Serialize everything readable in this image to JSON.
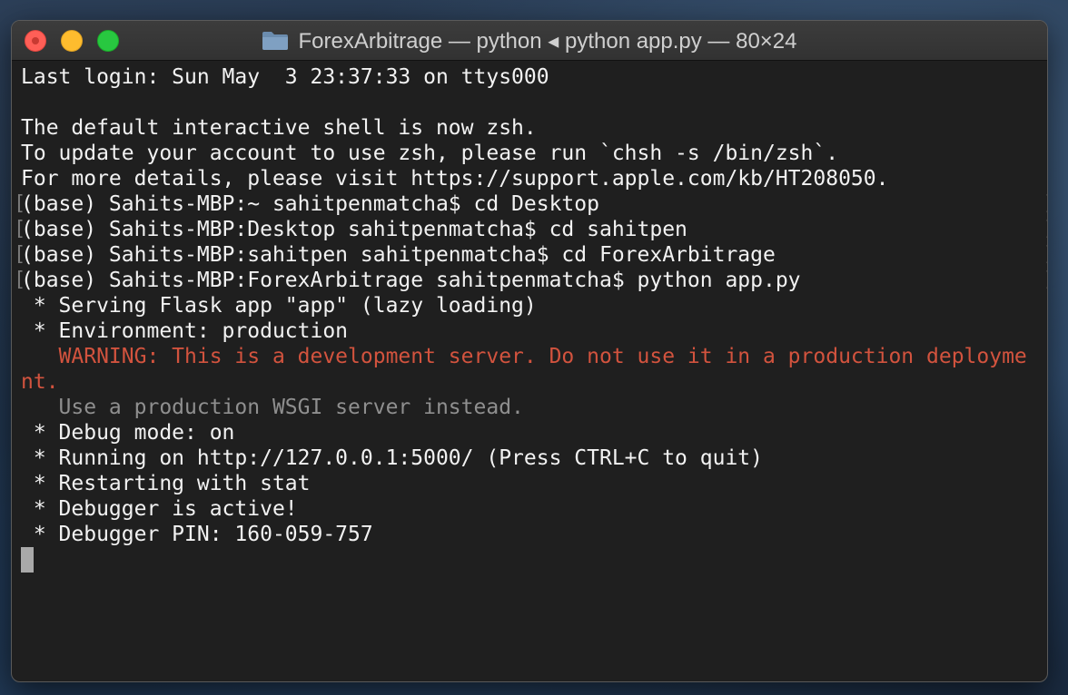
{
  "window": {
    "title": "ForexArbitrage — python ◂ python app.py — 80×24"
  },
  "terminal": {
    "lines": [
      {
        "text": "Last login: Sun May  3 23:37:33 on ttys000",
        "style": "normal",
        "marked": false
      },
      {
        "text": "",
        "style": "normal",
        "marked": false
      },
      {
        "text": "The default interactive shell is now zsh.",
        "style": "normal",
        "marked": false
      },
      {
        "text": "To update your account to use zsh, please run `chsh -s /bin/zsh`.",
        "style": "normal",
        "marked": false
      },
      {
        "text": "For more details, please visit https://support.apple.com/kb/HT208050.",
        "style": "normal",
        "marked": false
      },
      {
        "text": "(base) Sahits-MBP:~ sahitpenmatcha$ cd Desktop",
        "style": "normal",
        "marked": true
      },
      {
        "text": "(base) Sahits-MBP:Desktop sahitpenmatcha$ cd sahitpen",
        "style": "normal",
        "marked": true
      },
      {
        "text": "(base) Sahits-MBP:sahitpen sahitpenmatcha$ cd ForexArbitrage",
        "style": "normal",
        "marked": true
      },
      {
        "text": "(base) Sahits-MBP:ForexArbitrage sahitpenmatcha$ python app.py",
        "style": "normal",
        "marked": true
      },
      {
        "text": " * Serving Flask app \"app\" (lazy loading)",
        "style": "normal",
        "marked": false
      },
      {
        "text": " * Environment: production",
        "style": "normal",
        "marked": false
      },
      {
        "text": "   WARNING: This is a development server. Do not use it in a production deployme",
        "style": "warn",
        "marked": false
      },
      {
        "text": "nt.",
        "style": "warn",
        "marked": false
      },
      {
        "text": "   Use a production WSGI server instead.",
        "style": "dim",
        "marked": false
      },
      {
        "text": " * Debug mode: on",
        "style": "normal",
        "marked": false
      },
      {
        "text": " * Running on http://127.0.0.1:5000/ (Press CTRL+C to quit)",
        "style": "normal",
        "marked": false
      },
      {
        "text": " * Restarting with stat",
        "style": "normal",
        "marked": false
      },
      {
        "text": " * Debugger is active!",
        "style": "normal",
        "marked": false
      },
      {
        "text": " * Debugger PIN: 160-059-757",
        "style": "normal",
        "marked": false
      }
    ]
  },
  "colors": {
    "background": "#1f1f1f",
    "text": "#f2f2f2",
    "warning": "#d2533e",
    "dim": "#8f8f8f",
    "close": "#ff5f57",
    "minimize": "#febc2e",
    "zoom": "#28c840"
  }
}
